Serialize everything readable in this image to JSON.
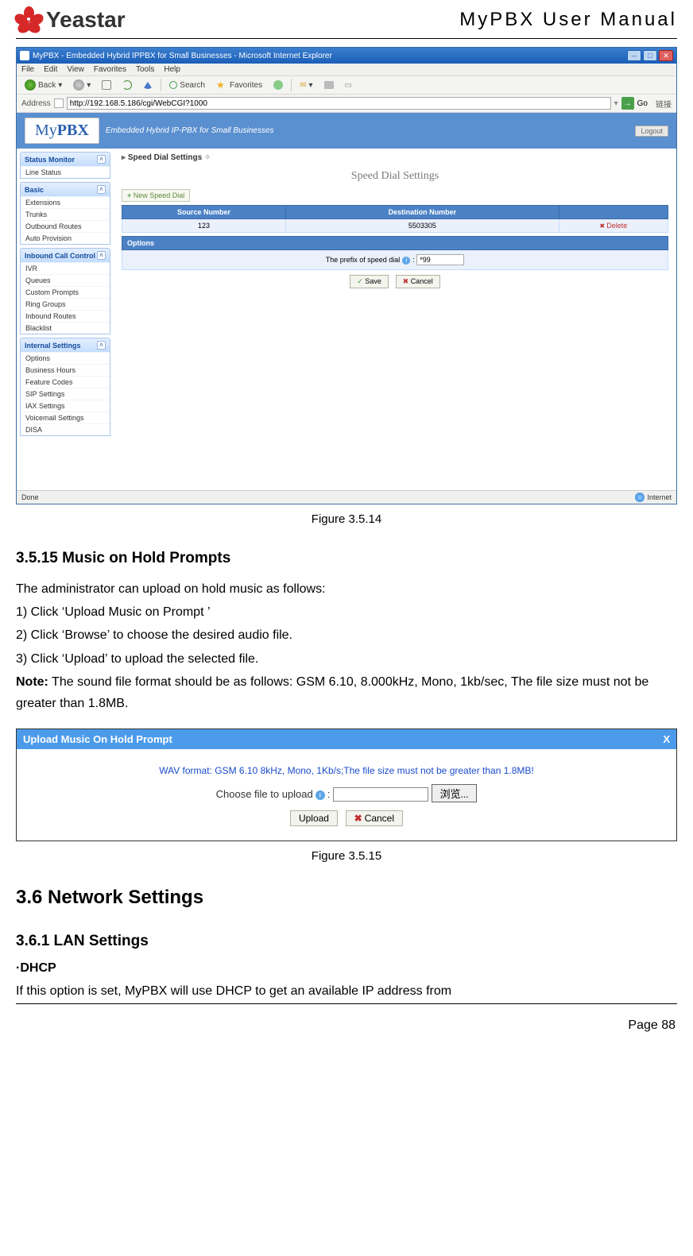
{
  "header": {
    "logo_text": "Yeastar",
    "doc_title": "MyPBX User Manual"
  },
  "ie": {
    "title": "MyPBX - Embedded Hybrid IPPBX for Small Businesses - Microsoft Internet Explorer",
    "menu": [
      "File",
      "Edit",
      "View",
      "Favorites",
      "Tools",
      "Help"
    ],
    "toolbar": {
      "back": "Back",
      "search": "Search",
      "favorites": "Favorites"
    },
    "addr_label": "Address",
    "url": "http://192.168.5.186/cgi/WebCGI?1000",
    "go": "Go",
    "links": "链接",
    "status_left": "Done",
    "status_right": "Internet"
  },
  "mypbx": {
    "logo_a": "My",
    "logo_b": "PBX",
    "tagline": "Embedded Hybrid IP-PBX for Small Businesses",
    "logout": "Logout",
    "panels": {
      "status_monitor": {
        "title": "Status Monitor",
        "items": [
          "Line Status"
        ]
      },
      "basic": {
        "title": "Basic",
        "items": [
          "Extensions",
          "Trunks",
          "Outbound Routes",
          "Auto Provision"
        ]
      },
      "inbound": {
        "title": "Inbound Call Control",
        "items": [
          "IVR",
          "Queues",
          "Custom Prompts",
          "Ring Groups",
          "Inbound Routes",
          "Blacklist"
        ]
      },
      "internal": {
        "title": "Internal Settings",
        "items": [
          "Options",
          "Business Hours",
          "Feature Codes",
          "SIP Settings",
          "IAX Settings",
          "Voicemail Settings",
          "DISA"
        ]
      }
    },
    "crumb": "Speed Dial Settings",
    "pin": "✧",
    "page_title": "Speed Dial Settings",
    "new_btn": "New Speed Dial",
    "table": {
      "col_src": "Source Number",
      "col_dst": "Destination Number",
      "row_src": "123",
      "row_dst": "5503305",
      "delete": "Delete"
    },
    "options_hd": "Options",
    "prefix_label": "The prefix of speed dial",
    "prefix_value": "*99",
    "save": "Save",
    "cancel": "Cancel"
  },
  "caption1": "Figure 3.5.14",
  "section_3_5_15": {
    "heading": "3.5.15 Music on Hold Prompts",
    "intro": "The administrator can upload on hold music as follows:",
    "step1": "1) Click ‘Upload Music on Prompt ’",
    "step2": "2) Click ‘Browse’ to choose the desired audio file.",
    "step3": "3) Click ‘Upload’ to upload the selected file.",
    "note_label": "Note:",
    "note_text": " The sound file format should be as follows: GSM 6.10, 8.000kHz, Mono, 1kb/sec, The file size must not be greater than 1.8MB."
  },
  "dialog": {
    "title": "Upload Music On Hold Prompt",
    "warn": "WAV format: GSM 6.10 8kHz, Mono, 1Kb/s;The file size must not be greater than 1.8MB!",
    "choose_label": "Choose file to upload",
    "browse": "浏览...",
    "upload": "Upload",
    "cancel": "Cancel"
  },
  "caption2": "Figure 3.5.15",
  "section_3_6": {
    "heading": "3.6 Network Settings",
    "sub": "3.6.1 LAN Settings",
    "dhcp_label": "·DHCP",
    "dhcp_text": "If this option is set, MyPBX will use DHCP to get an available IP address from"
  },
  "footer": "Page 88"
}
